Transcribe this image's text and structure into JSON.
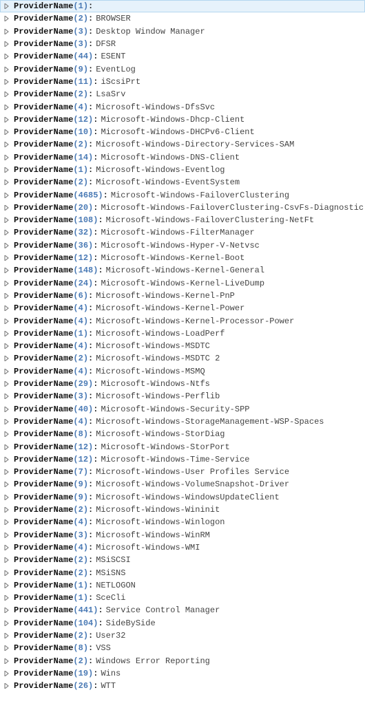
{
  "key_label": "ProviderName",
  "rows": [
    {
      "count": 1,
      "name": "",
      "selected": true
    },
    {
      "count": 2,
      "name": "BROWSER"
    },
    {
      "count": 3,
      "name": "Desktop Window Manager"
    },
    {
      "count": 3,
      "name": "DFSR"
    },
    {
      "count": 44,
      "name": "ESENT"
    },
    {
      "count": 9,
      "name": "EventLog"
    },
    {
      "count": 11,
      "name": "iScsiPrt"
    },
    {
      "count": 2,
      "name": "LsaSrv"
    },
    {
      "count": 4,
      "name": "Microsoft-Windows-DfsSvc"
    },
    {
      "count": 12,
      "name": "Microsoft-Windows-Dhcp-Client"
    },
    {
      "count": 10,
      "name": "Microsoft-Windows-DHCPv6-Client"
    },
    {
      "count": 2,
      "name": "Microsoft-Windows-Directory-Services-SAM"
    },
    {
      "count": 14,
      "name": "Microsoft-Windows-DNS-Client"
    },
    {
      "count": 1,
      "name": "Microsoft-Windows-Eventlog"
    },
    {
      "count": 2,
      "name": "Microsoft-Windows-EventSystem"
    },
    {
      "count": 4685,
      "name": "Microsoft-Windows-FailoverClustering"
    },
    {
      "count": 20,
      "name": "Microsoft-Windows-FailoverClustering-CsvFs-Diagnostic"
    },
    {
      "count": 108,
      "name": "Microsoft-Windows-FailoverClustering-NetFt"
    },
    {
      "count": 32,
      "name": "Microsoft-Windows-FilterManager"
    },
    {
      "count": 36,
      "name": "Microsoft-Windows-Hyper-V-Netvsc"
    },
    {
      "count": 12,
      "name": "Microsoft-Windows-Kernel-Boot"
    },
    {
      "count": 148,
      "name": "Microsoft-Windows-Kernel-General"
    },
    {
      "count": 24,
      "name": "Microsoft-Windows-Kernel-LiveDump"
    },
    {
      "count": 6,
      "name": "Microsoft-Windows-Kernel-PnP"
    },
    {
      "count": 4,
      "name": "Microsoft-Windows-Kernel-Power"
    },
    {
      "count": 4,
      "name": "Microsoft-Windows-Kernel-Processor-Power"
    },
    {
      "count": 1,
      "name": "Microsoft-Windows-LoadPerf"
    },
    {
      "count": 4,
      "name": "Microsoft-Windows-MSDTC"
    },
    {
      "count": 2,
      "name": "Microsoft-Windows-MSDTC 2"
    },
    {
      "count": 4,
      "name": "Microsoft-Windows-MSMQ"
    },
    {
      "count": 29,
      "name": "Microsoft-Windows-Ntfs"
    },
    {
      "count": 3,
      "name": "Microsoft-Windows-Perflib"
    },
    {
      "count": 40,
      "name": "Microsoft-Windows-Security-SPP"
    },
    {
      "count": 4,
      "name": "Microsoft-Windows-StorageManagement-WSP-Spaces"
    },
    {
      "count": 8,
      "name": "Microsoft-Windows-StorDiag"
    },
    {
      "count": 12,
      "name": "Microsoft-Windows-StorPort"
    },
    {
      "count": 12,
      "name": "Microsoft-Windows-Time-Service"
    },
    {
      "count": 7,
      "name": "Microsoft-Windows-User Profiles Service"
    },
    {
      "count": 9,
      "name": "Microsoft-Windows-VolumeSnapshot-Driver"
    },
    {
      "count": 9,
      "name": "Microsoft-Windows-WindowsUpdateClient"
    },
    {
      "count": 2,
      "name": "Microsoft-Windows-Wininit"
    },
    {
      "count": 4,
      "name": "Microsoft-Windows-Winlogon"
    },
    {
      "count": 3,
      "name": "Microsoft-Windows-WinRM"
    },
    {
      "count": 4,
      "name": "Microsoft-Windows-WMI"
    },
    {
      "count": 2,
      "name": "MSiSCSI"
    },
    {
      "count": 2,
      "name": "MSiSNS"
    },
    {
      "count": 1,
      "name": "NETLOGON"
    },
    {
      "count": 1,
      "name": "SceCli"
    },
    {
      "count": 441,
      "name": "Service Control Manager"
    },
    {
      "count": 104,
      "name": "SideBySide"
    },
    {
      "count": 2,
      "name": "User32"
    },
    {
      "count": 8,
      "name": "VSS"
    },
    {
      "count": 2,
      "name": "Windows Error Reporting"
    },
    {
      "count": 19,
      "name": "Wins"
    },
    {
      "count": 26,
      "name": "WTT"
    }
  ]
}
